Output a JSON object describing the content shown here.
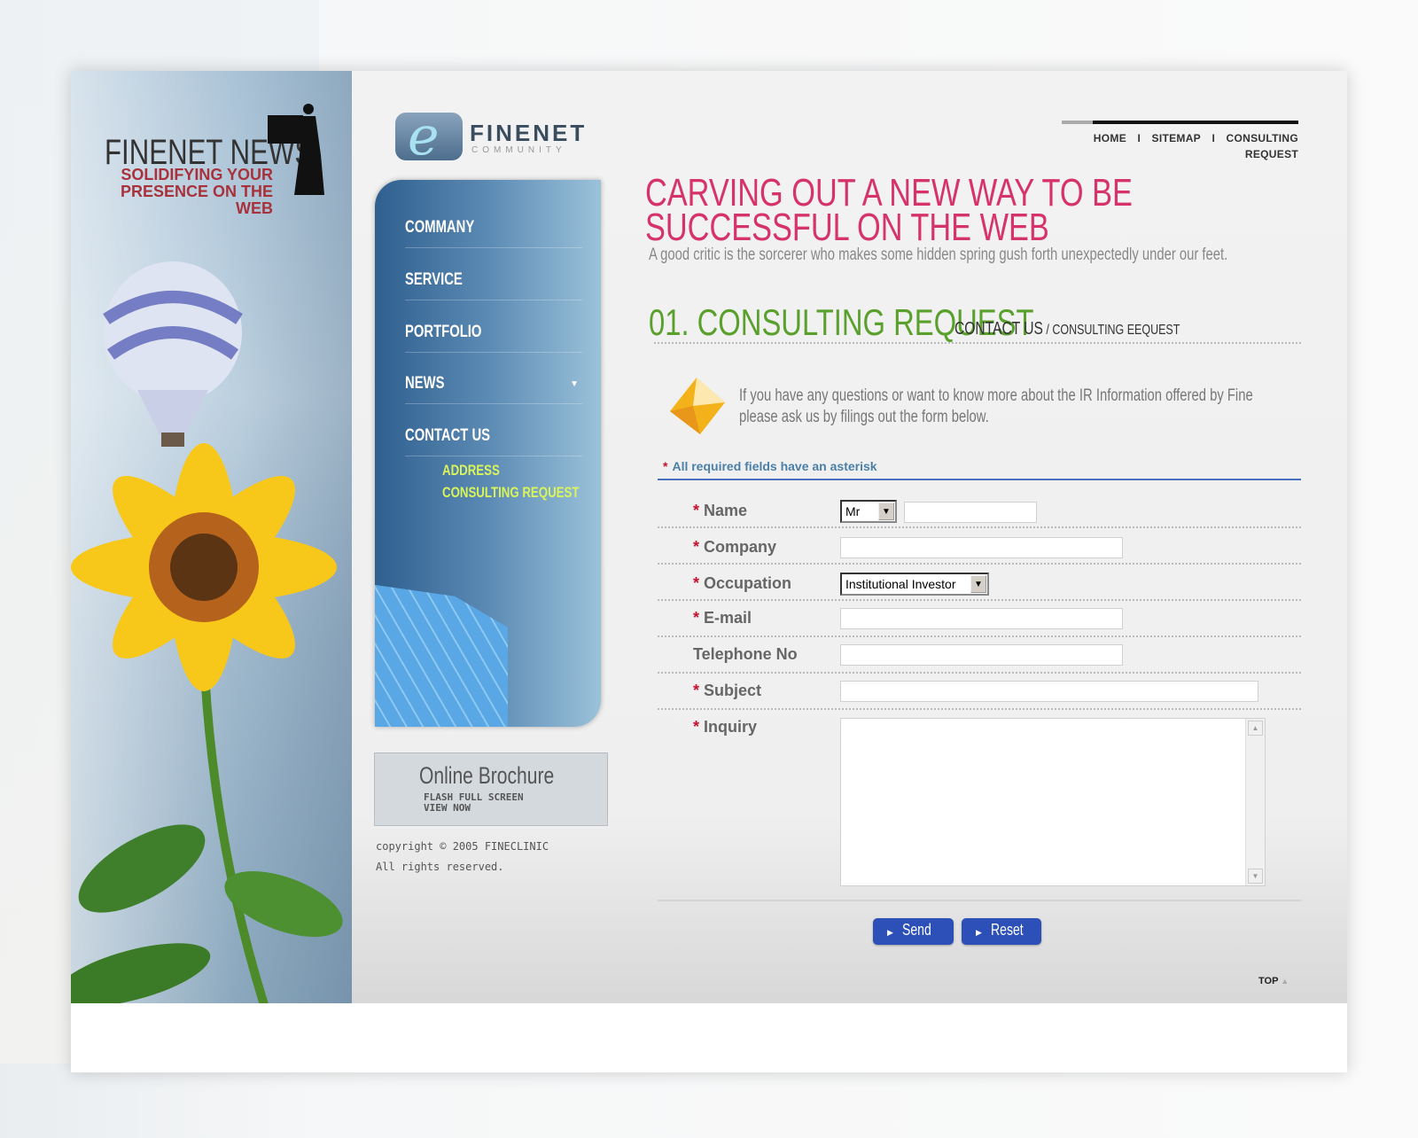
{
  "side": {
    "title": "FINENET NEWS",
    "tagline_1": "SOLIDIFYING YOUR",
    "tagline_2": "PRESENCE ON THE WEB"
  },
  "logo": {
    "name": "FINENET",
    "sub": "COMMUNITY"
  },
  "nav": {
    "items": [
      {
        "label": "COMMANY"
      },
      {
        "label": "SERVICE"
      },
      {
        "label": "PORTFOLIO"
      },
      {
        "label": "NEWS"
      },
      {
        "label": "CONTACT US"
      }
    ],
    "sub_items": [
      {
        "label": "ADDRESS"
      },
      {
        "label": "CONSULTING REQUEST"
      }
    ]
  },
  "brochure": {
    "title": "Online Brochure",
    "line1": "FLASH  FULL SCREEN",
    "line2": "VIEW NOW"
  },
  "copyright": {
    "line1": "copyright © 2005 FINECLINIC",
    "line2": "All rights reserved."
  },
  "topnav": {
    "links": [
      "HOME",
      "SITEMAP",
      "CONSULTING REQUEST"
    ],
    "sep": "I"
  },
  "headline": {
    "line1": "CARVING OUT A NEW WAY TO BE",
    "line2": "SUCCESSFUL ON THE WEB",
    "quote": "A good critic is the sorcerer who makes some hidden spring gush forth unexpectedly under our feet."
  },
  "section": {
    "title": "01. CONSULTING REQUEST",
    "crumb_main": "CONTACT US",
    "crumb_rest": " / CONSULTING EEQUEST"
  },
  "intro": {
    "line1": "If you have any questions or want to know more about the IR Information offered by Fine",
    "line2": "please ask us by filings out the form below."
  },
  "form": {
    "required_note": "All required fields have an asterisk",
    "asterisk": "*",
    "fields": [
      {
        "label": "Name",
        "required": true
      },
      {
        "label": "Company",
        "required": true
      },
      {
        "label": "Occupation",
        "required": true
      },
      {
        "label": "E-mail",
        "required": true
      },
      {
        "label": "Telephone No",
        "required": false
      },
      {
        "label": "Subject",
        "required": true
      },
      {
        "label": "Inquiry",
        "required": true
      }
    ],
    "title_select": "Mr",
    "occupation_select": "Institutional Investor",
    "send_label": "Send",
    "reset_label": "Reset"
  },
  "top_label": "TOP",
  "colors": {
    "headline": "#d6336b",
    "section": "#5aa02c",
    "nav_sub": "#d9f55a",
    "button": "#2d4fb8",
    "accent_line": "#4a70c0"
  }
}
